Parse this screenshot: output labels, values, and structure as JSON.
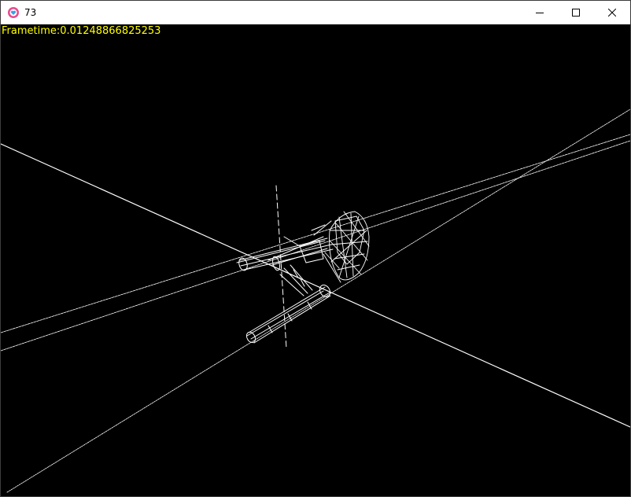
{
  "window": {
    "title": "73",
    "app_icon": "ring-heart-icon",
    "controls": [
      "minimize-icon",
      "maximize-icon",
      "close-icon"
    ]
  },
  "viewport": {
    "overlay_text": "Frametime:0.01248866825253",
    "overlay_color": "#ffff00",
    "background": "#000000",
    "wire_color": "#ffffff"
  }
}
